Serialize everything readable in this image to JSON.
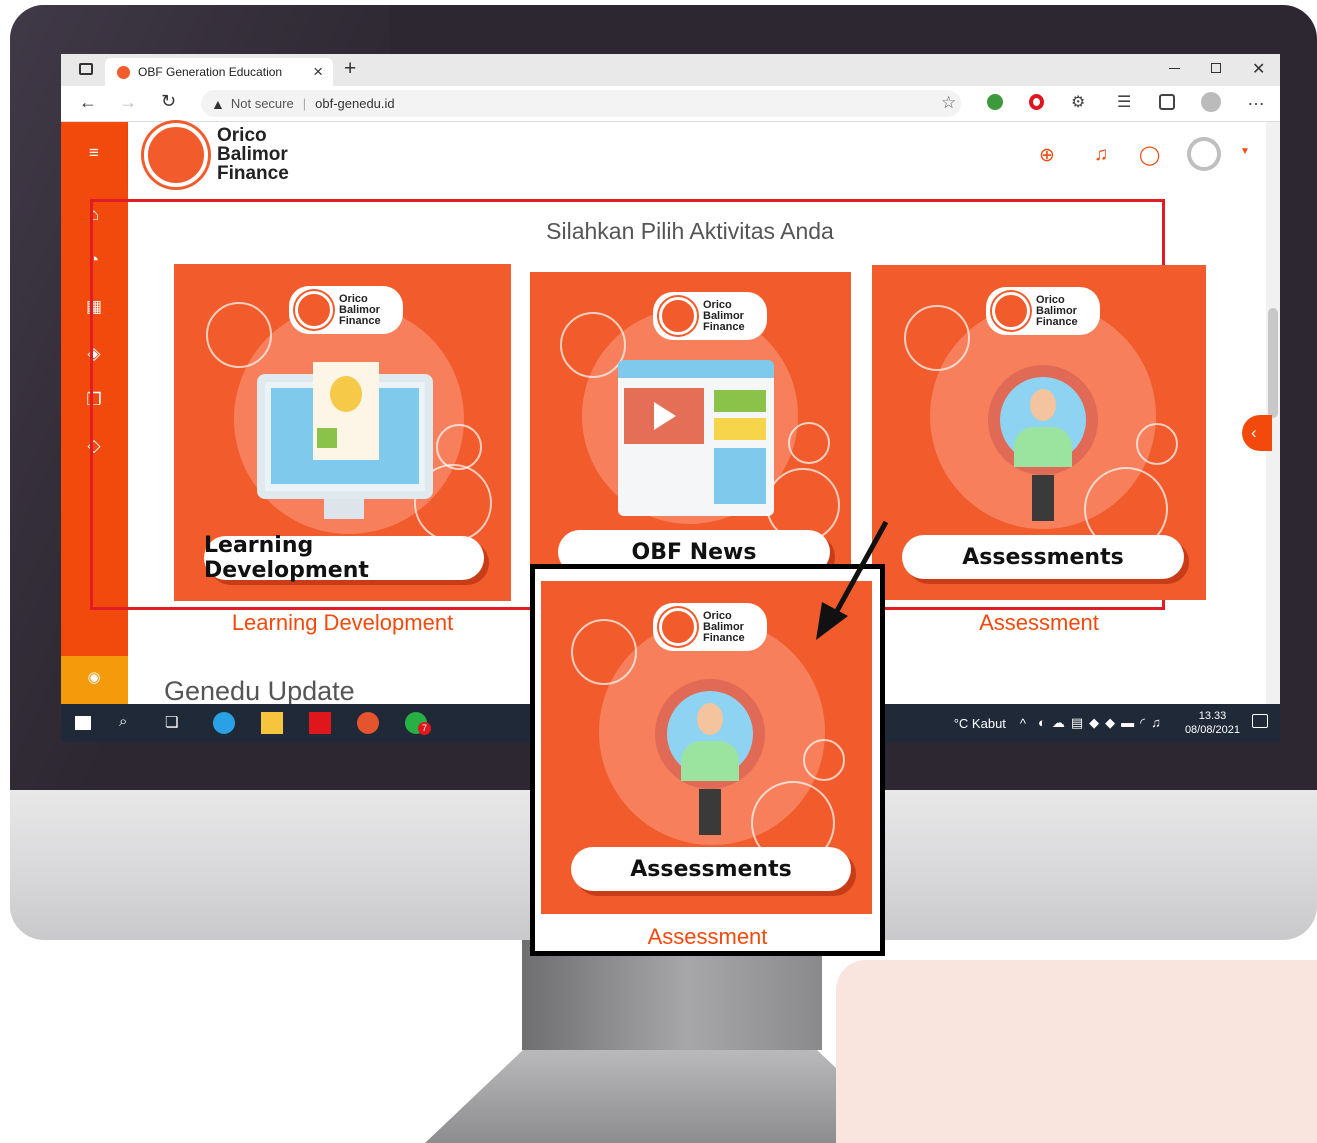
{
  "browser": {
    "tab_title": "OBF Generation Education",
    "security_label": "Not secure",
    "url": "obf-genedu.id",
    "new_tab_glyph": "+",
    "close_tab_glyph": "×"
  },
  "brand": {
    "logo_text_line1": "Orico",
    "logo_text_line2": "Balimor",
    "logo_text_line3": "Finance",
    "color_primary": "#f24a0c"
  },
  "page": {
    "heading": "Silahkan Pilih Aktivitas Anda",
    "section_title": "Genedu Update"
  },
  "cards": [
    {
      "title": "Learning Development",
      "caption": "Learning Development",
      "icon": "computer-lightbulb-icon"
    },
    {
      "title": "OBF News",
      "caption": "",
      "icon": "browser-video-icon"
    },
    {
      "title": "Assessments",
      "caption": "Assessment",
      "icon": "magnifier-person-icon"
    }
  ],
  "zoom": {
    "title": "Assessments",
    "caption": "Assessment"
  },
  "taskbar": {
    "weather": "°C Kabut",
    "time": "13.33",
    "date": "08/08/2021",
    "whatsapp_badge": "7"
  }
}
